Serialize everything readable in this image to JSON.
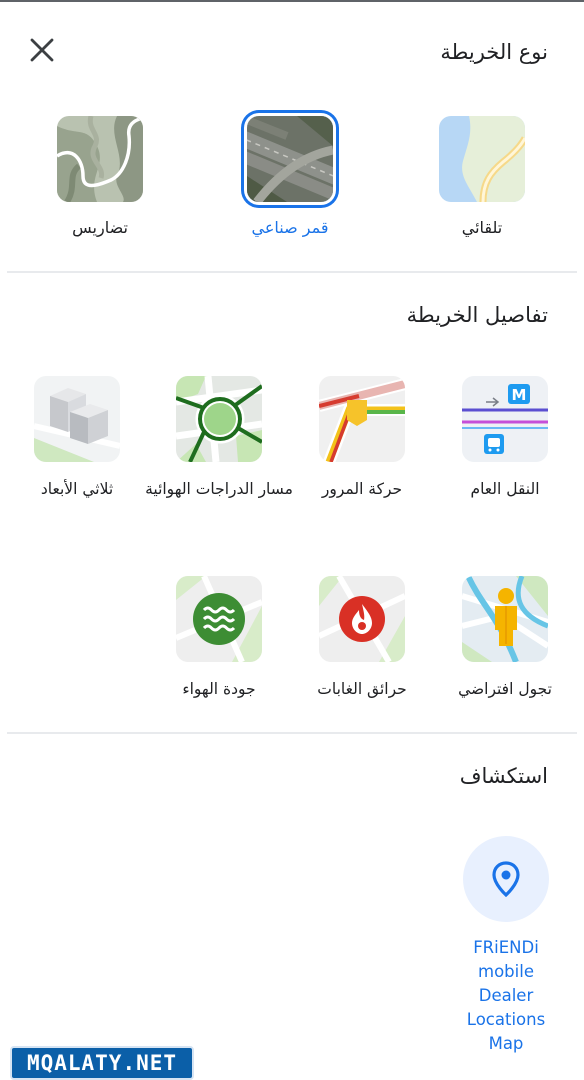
{
  "header": {
    "title": "نوع الخريطة",
    "close_icon": "close-icon"
  },
  "map_types": [
    {
      "label": "تلقائي",
      "selected": false,
      "icon": "default-map-thumbnail"
    },
    {
      "label": "قمر صناعي",
      "selected": true,
      "icon": "satellite-map-thumbnail"
    },
    {
      "label": "تضاريس",
      "selected": false,
      "icon": "terrain-map-thumbnail"
    }
  ],
  "details": {
    "title": "تفاصيل الخريطة",
    "items": [
      {
        "label": "النقل العام",
        "icon": "transit-thumbnail"
      },
      {
        "label": "حركة المرور",
        "icon": "traffic-thumbnail"
      },
      {
        "label": "مسار الدراجات الهوائية",
        "icon": "biking-thumbnail"
      },
      {
        "label": "ثلاثي الأبعاد",
        "icon": "3d-thumbnail"
      },
      {
        "label": "تجول افتراضي",
        "icon": "street-view-thumbnail"
      },
      {
        "label": "حرائق الغابات",
        "icon": "wildfires-thumbnail"
      },
      {
        "label": "جودة الهواء",
        "icon": "air-quality-thumbnail"
      }
    ]
  },
  "explore": {
    "title": "استكشاف",
    "items": [
      {
        "label": "FRiENDi mobile Dealer Locations Map",
        "icon": "location-pin-icon"
      }
    ]
  },
  "watermark": {
    "text": "MQALATY.NET"
  },
  "colors": {
    "accent": "#1a73e8",
    "divider": "#e8eaed",
    "text": "#202124"
  }
}
